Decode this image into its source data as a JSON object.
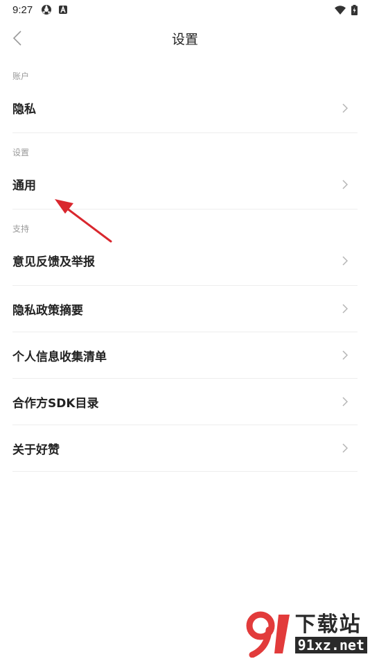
{
  "status_bar": {
    "time": "9:27"
  },
  "header": {
    "title": "设置"
  },
  "sections": [
    {
      "header": "账户",
      "items": [
        {
          "label": "隐私"
        }
      ]
    },
    {
      "header": "设置",
      "items": [
        {
          "label": "通用"
        }
      ]
    },
    {
      "header": "支持",
      "items": [
        {
          "label": "意见反馈及举报"
        },
        {
          "label": "隐私政策摘要"
        },
        {
          "label": "个人信息收集清单"
        },
        {
          "label": "合作方SDK目录"
        },
        {
          "label": "关于好赞"
        }
      ]
    }
  ],
  "watermark": {
    "title": "下载站",
    "url": "91xz.net"
  },
  "colors": {
    "annotation_arrow": "#d9272e",
    "watermark_red": "#e23b3b"
  }
}
